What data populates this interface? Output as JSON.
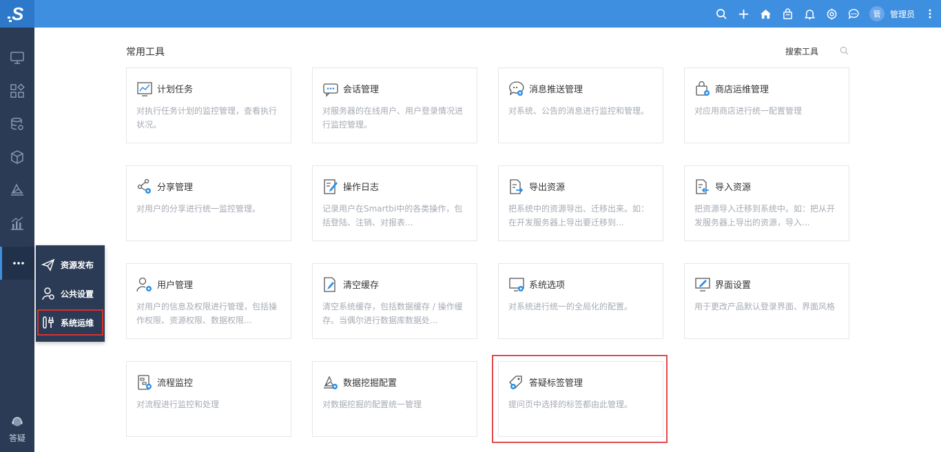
{
  "header": {
    "logo_letter": "S",
    "avatar_text": "管",
    "username": "管理员",
    "icons": [
      "search-icon",
      "plus-icon",
      "home-icon",
      "bag-icon",
      "bell-icon",
      "settings-gear-icon",
      "chat-icon"
    ]
  },
  "sidebar": {
    "items": [
      "monitor-icon",
      "grid-icon",
      "database-icon",
      "cube-icon",
      "layers-icon",
      "chart-icon",
      "more-icon"
    ],
    "help_label": "答疑"
  },
  "flyout": {
    "items": [
      {
        "label": "资源发布",
        "icon": "send-icon"
      },
      {
        "label": "公共设置",
        "icon": "user-gear-icon"
      },
      {
        "label": "系统运维",
        "icon": "tools-icon"
      }
    ]
  },
  "main": {
    "section_title": "常用工具",
    "search_label": "搜索工具",
    "cards": [
      {
        "title": "计划任务",
        "desc": "对执行任务计划的监控管理，查看执行状况。",
        "icon": "schedule-chart-icon"
      },
      {
        "title": "会话管理",
        "desc": "对服务器的在线用户、用户登录情况进行监控管理。",
        "icon": "session-icon"
      },
      {
        "title": "消息推送管理",
        "desc": "对系统、公告的消息进行监控和管理。",
        "icon": "message-push-icon"
      },
      {
        "title": "商店运维管理",
        "desc": "对应用商店进行统一配置管理",
        "icon": "store-ops-icon"
      },
      {
        "title": "分享管理",
        "desc": "对用户的分享进行统一监控管理。",
        "icon": "share-icon"
      },
      {
        "title": "操作日志",
        "desc": "记录用户在Smartbi中的各类操作，包括登陆、注销、对报表...",
        "icon": "log-icon"
      },
      {
        "title": "导出资源",
        "desc": "把系统中的资源导出、迁移出来。如：在开发服务器上导出要迁移到...",
        "icon": "export-icon"
      },
      {
        "title": "导入资源",
        "desc": "把资源导入迁移到系统中。如：把从开发服务器上导出的资源，导入...",
        "icon": "import-icon"
      },
      {
        "title": "用户管理",
        "desc": "对用户的信息及权限进行管理，包括操作权限、资源权限、数据权限...",
        "icon": "user-manage-icon"
      },
      {
        "title": "清空缓存",
        "desc": "清空系统缓存，包括数据缓存 / 操作缓存。当偶尔进行数据库数据处...",
        "icon": "clear-cache-icon"
      },
      {
        "title": "系统选项",
        "desc": "对系统进行统一的全局化的配置。",
        "icon": "system-options-icon"
      },
      {
        "title": "界面设置",
        "desc": "用于更改产品默认登录界面、界面风格",
        "icon": "ui-settings-icon"
      },
      {
        "title": "流程监控",
        "desc": "对流程进行监控和处理",
        "icon": "flow-monitor-icon"
      },
      {
        "title": "数据挖掘配置",
        "desc": "对数据挖掘的配置统一管理",
        "icon": "data-mining-icon"
      },
      {
        "title": "答疑标签管理",
        "desc": "提问页中选择的标签都由此管理。",
        "icon": "tag-manage-icon"
      }
    ]
  }
}
